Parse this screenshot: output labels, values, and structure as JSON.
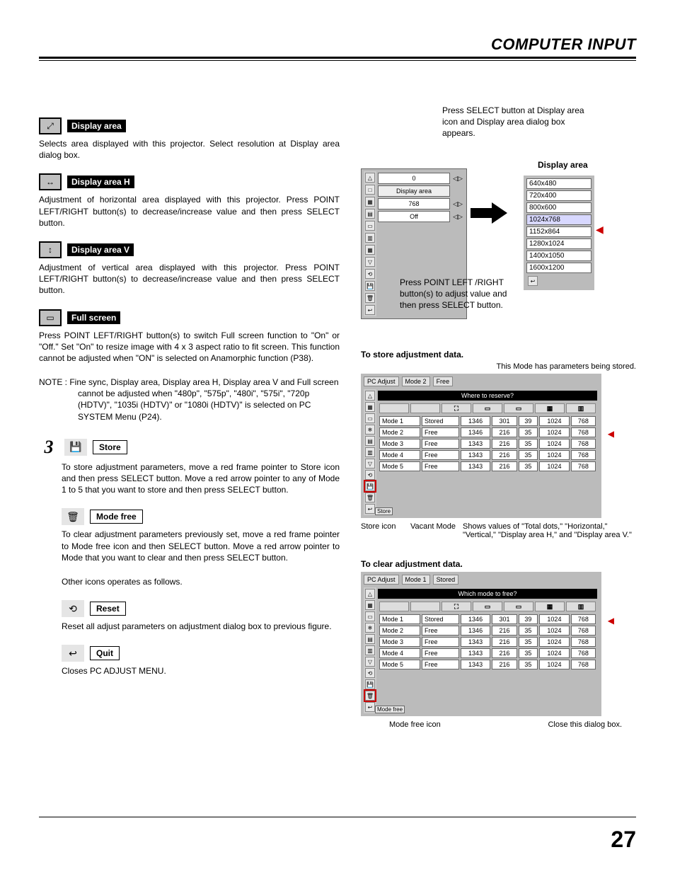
{
  "header": {
    "title": "COMPUTER INPUT"
  },
  "left": {
    "display_area": {
      "label": "Display area",
      "text": "Selects area displayed with this projector. Select resolution at Display area dialog box."
    },
    "display_area_h": {
      "label": "Display area H",
      "text": "Adjustment of horizontal area displayed with this projector.  Press POINT LEFT/RIGHT button(s) to decrease/increase value and then press SELECT button."
    },
    "display_area_v": {
      "label": "Display area V",
      "text": "Adjustment of vertical area displayed with this projector.  Press POINT LEFT/RIGHT button(s) to decrease/increase value and then press SELECT button."
    },
    "full_screen": {
      "label": "Full screen",
      "text": "Press POINT LEFT/RIGHT button(s) to switch Full screen function to \"On\" or \"Off.\"  Set \"On\" to resize image with 4 x 3 aspect ratio to fit screen. This function cannot be adjusted when \"ON\" is selected on Anamorphic function (P38)."
    },
    "note": "NOTE :  Fine sync, Display area, Display area H, Display area V and Full screen cannot be adjusted when \"480p\", \"575p\", \"480i\", \"575i\", \"720p (HDTV)\", \"1035i (HDTV)\" or \"1080i (HDTV)\" is selected on PC SYSTEM Menu (P24).",
    "step3": {
      "num": "3",
      "store": {
        "label": "Store",
        "text": "To store adjustment parameters, move a red frame pointer to Store icon and then press SELECT button.  Move a red arrow pointer to any of Mode 1 to 5 that you want to store and then press SELECT button."
      },
      "mode_free": {
        "label": "Mode free",
        "text": "To clear adjustment parameters previously set, move a red frame pointer to Mode free icon and then SELECT button.  Move a red arrow pointer to Mode that you want to clear and then press SELECT button."
      },
      "other": "Other icons operates as follows.",
      "reset": {
        "label": "Reset",
        "text": "Reset all adjust parameters on adjustment dialog box to previous figure."
      },
      "quit": {
        "label": "Quit",
        "text": "Closes PC ADJUST MENU."
      }
    }
  },
  "right": {
    "fig1": {
      "caption_top": "Press SELECT button at Display area icon and Display area dialog box appears.",
      "title": "Display area",
      "panel_rows": [
        {
          "label": "",
          "value": "0"
        },
        {
          "label": "Display area",
          "value": ""
        },
        {
          "label": "",
          "value": "768"
        },
        {
          "label": "",
          "value": "Off"
        }
      ],
      "resolutions": [
        "640x480",
        "720x400",
        "800x600",
        "1024x768",
        "1152x864",
        "1280x1024",
        "1400x1050",
        "1600x1200"
      ],
      "caption_mid": "Press POINT LEFT /RIGHT button(s) to adjust value and then press SELECT button."
    },
    "fig2": {
      "title": "To store adjustment data.",
      "caption_sub": "This Mode has parameters being stored.",
      "topbar": {
        "menu": "PC Adjust",
        "mode": "Mode 2",
        "status": "Free"
      },
      "q_title": "Where to reserve?",
      "rows": [
        {
          "mode": "Mode 1",
          "status": "Stored",
          "c1": "1346",
          "c2": "301",
          "c3": "39",
          "c4": "1024",
          "c5": "768"
        },
        {
          "mode": "Mode 2",
          "status": "Free",
          "c1": "1346",
          "c2": "216",
          "c3": "35",
          "c4": "1024",
          "c5": "768"
        },
        {
          "mode": "Mode 3",
          "status": "Free",
          "c1": "1343",
          "c2": "216",
          "c3": "35",
          "c4": "1024",
          "c5": "768"
        },
        {
          "mode": "Mode 4",
          "status": "Free",
          "c1": "1343",
          "c2": "216",
          "c3": "35",
          "c4": "1024",
          "c5": "768"
        },
        {
          "mode": "Mode 5",
          "status": "Free",
          "c1": "1343",
          "c2": "216",
          "c3": "35",
          "c4": "1024",
          "c5": "768"
        }
      ],
      "row_label": "Store",
      "annots": {
        "a1": "Store icon",
        "a2": "Vacant Mode",
        "a3": "Shows values of \"Total dots,\" \"Horizontal,\" \"Vertical,\" \"Display area H,\" and \"Display area V.\""
      }
    },
    "fig3": {
      "title": "To clear adjustment data.",
      "topbar": {
        "menu": "PC Adjust",
        "mode": "Mode 1",
        "status": "Stored"
      },
      "q_title": "Which mode to free?",
      "rows": [
        {
          "mode": "Mode 1",
          "status": "Stored",
          "c1": "1346",
          "c2": "301",
          "c3": "39",
          "c4": "1024",
          "c5": "768"
        },
        {
          "mode": "Mode 2",
          "status": "Free",
          "c1": "1346",
          "c2": "216",
          "c3": "35",
          "c4": "1024",
          "c5": "768"
        },
        {
          "mode": "Mode 3",
          "status": "Free",
          "c1": "1343",
          "c2": "216",
          "c3": "35",
          "c4": "1024",
          "c5": "768"
        },
        {
          "mode": "Mode 4",
          "status": "Free",
          "c1": "1343",
          "c2": "216",
          "c3": "35",
          "c4": "1024",
          "c5": "768"
        },
        {
          "mode": "Mode 5",
          "status": "Free",
          "c1": "1343",
          "c2": "216",
          "c3": "35",
          "c4": "1024",
          "c5": "768"
        }
      ],
      "row_label": "Mode free",
      "annots": {
        "a1": "Mode free icon",
        "a2": "Close this dialog box."
      }
    }
  },
  "page_number": "27"
}
